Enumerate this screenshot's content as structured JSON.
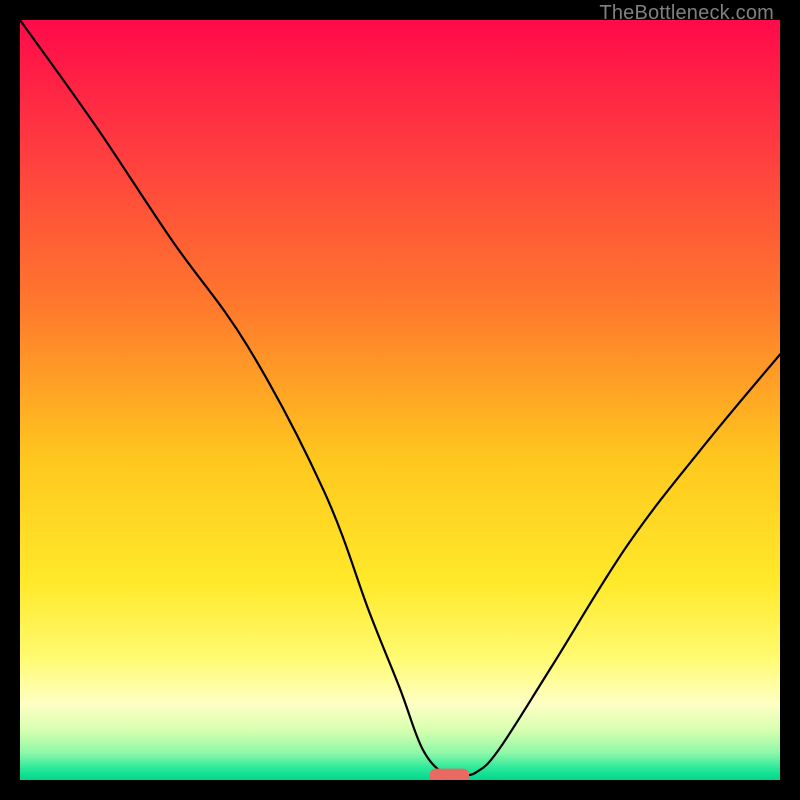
{
  "watermark": "TheBottleneck.com",
  "chart_data": {
    "type": "line",
    "title": "",
    "xlabel": "",
    "ylabel": "",
    "xlim": [
      0,
      100
    ],
    "ylim": [
      0,
      100
    ],
    "grid": false,
    "series": [
      {
        "name": "bottleneck-curve",
        "x": [
          0,
          10,
          20,
          30,
          40,
          46,
          50,
          53,
          56,
          58,
          60,
          63,
          70,
          80,
          90,
          100
        ],
        "y": [
          100,
          86,
          71,
          57,
          38,
          22,
          12,
          4,
          0.7,
          0.7,
          1,
          4,
          15,
          31,
          44,
          56
        ]
      }
    ],
    "marker": {
      "name": "optimal-marker",
      "x_center": 56.5,
      "x_halfwidth": 2.6,
      "y": 0.6,
      "height": 1.8,
      "color": "#e86a62"
    },
    "background_gradient": {
      "direction": "vertical",
      "stops": [
        {
          "pos": 0.0,
          "color": "#ff0a4a"
        },
        {
          "pos": 0.18,
          "color": "#ff3f3f"
        },
        {
          "pos": 0.38,
          "color": "#ff7a2c"
        },
        {
          "pos": 0.58,
          "color": "#ffc81e"
        },
        {
          "pos": 0.74,
          "color": "#ffe92a"
        },
        {
          "pos": 0.84,
          "color": "#fffb72"
        },
        {
          "pos": 0.9,
          "color": "#ffffc4"
        },
        {
          "pos": 0.935,
          "color": "#d6ffb0"
        },
        {
          "pos": 0.965,
          "color": "#8cf7a8"
        },
        {
          "pos": 0.985,
          "color": "#28e89a"
        },
        {
          "pos": 1.0,
          "color": "#00d78c"
        }
      ]
    }
  }
}
